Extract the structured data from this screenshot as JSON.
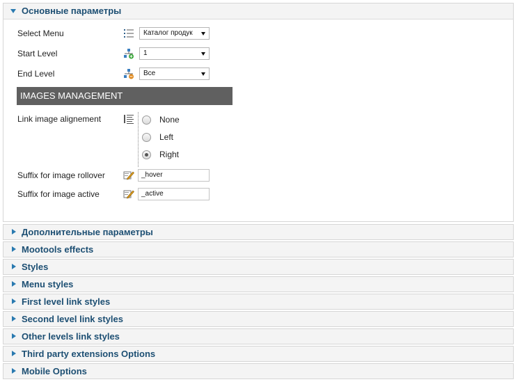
{
  "main_panel": {
    "title": "Основные параметры",
    "fields": {
      "select_menu": {
        "label": "Select Menu",
        "value": "Каталог продук"
      },
      "start_level": {
        "label": "Start Level",
        "value": "1"
      },
      "end_level": {
        "label": "End Level",
        "value": "Все"
      }
    },
    "images_section": "IMAGES MANAGEMENT",
    "link_align": {
      "label": "Link image alignement",
      "options": [
        "None",
        "Left",
        "Right"
      ],
      "selected": "Right"
    },
    "rollover": {
      "label": "Suffix for image rollover",
      "value": "_hover"
    },
    "active": {
      "label": "Suffix for image active",
      "value": "_active"
    }
  },
  "collapsed_panels": [
    "Дополнительные параметры",
    "Mootools effects",
    "Styles",
    "Menu styles",
    "First level link styles",
    "Second level link styles",
    "Other levels link styles",
    "Third party extensions Options",
    "Mobile Options"
  ],
  "icons": {
    "select_menu": "list-icon",
    "start_level": "tree-add-icon",
    "end_level": "tree-remove-icon",
    "align": "align-list-icon",
    "rollover": "pencil-icon",
    "active": "pencil-icon"
  }
}
